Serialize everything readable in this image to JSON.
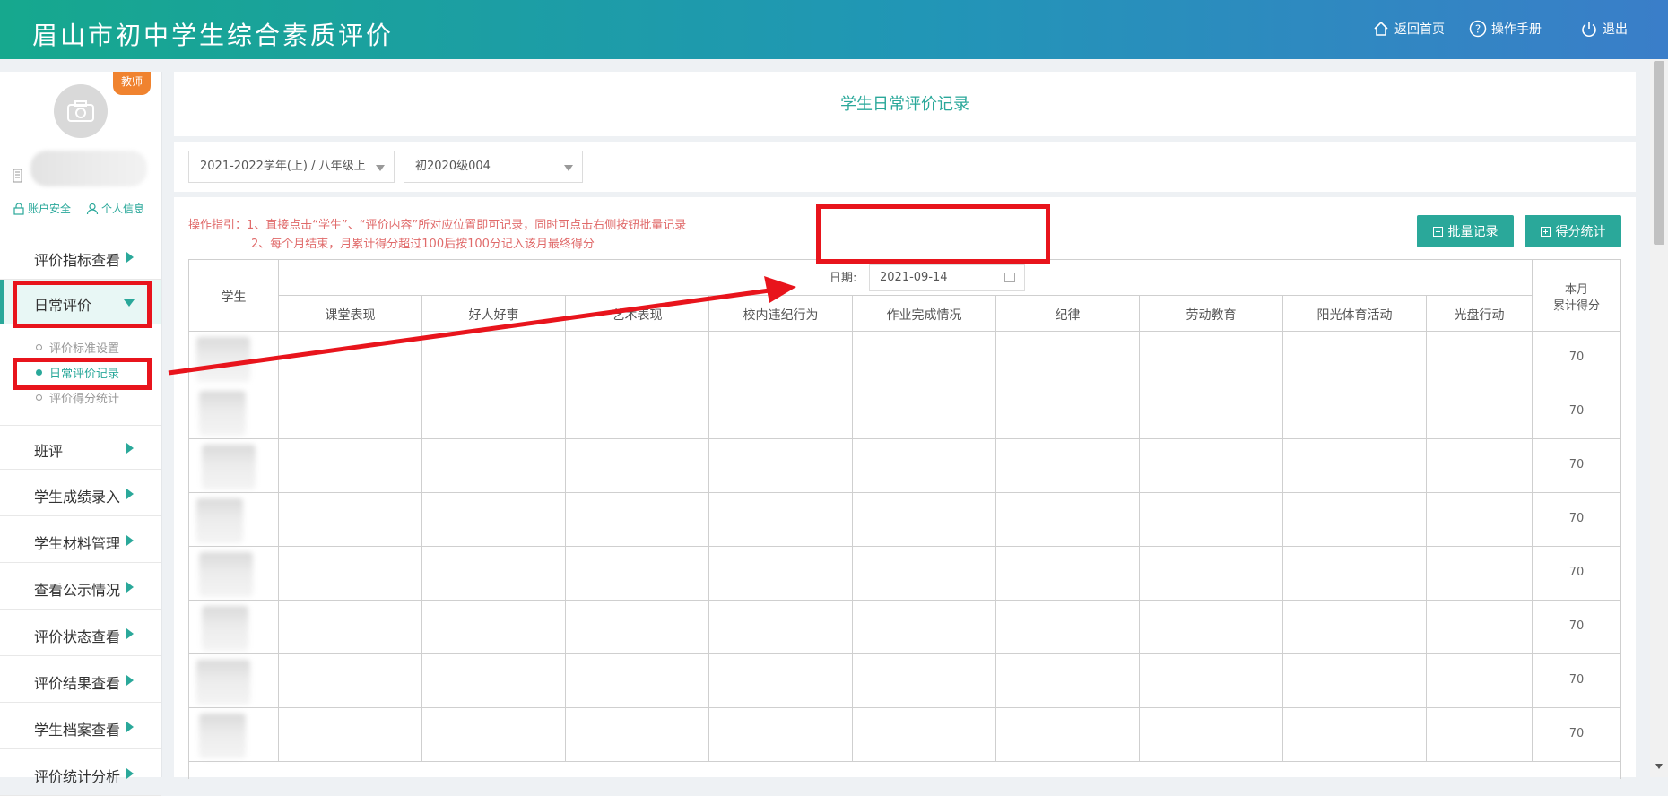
{
  "header": {
    "app_title": "眉山市初中学生综合素质评价",
    "links": [
      {
        "label": "返回首页",
        "icon": "home-icon"
      },
      {
        "label": "操作手册",
        "icon": "help-icon"
      },
      {
        "label": "退出",
        "icon": "power-icon"
      }
    ]
  },
  "profile": {
    "role_badge": "教师",
    "account_security": "账户安全",
    "personal_info": "个人信息"
  },
  "sidebar": {
    "items": [
      {
        "label": "评价指标查看"
      },
      {
        "label": "日常评价"
      },
      {
        "label": "班评"
      },
      {
        "label": "学生成绩录入"
      },
      {
        "label": "学生材料管理"
      },
      {
        "label": "查看公示情况"
      },
      {
        "label": "评价状态查看"
      },
      {
        "label": "评价结果查看"
      },
      {
        "label": "学生档案查看"
      },
      {
        "label": "评价统计分析"
      }
    ],
    "sub_items": [
      {
        "label": "评价标准设置"
      },
      {
        "label": "日常评价记录"
      },
      {
        "label": "评价得分统计"
      }
    ]
  },
  "page": {
    "title": "学生日常评价记录",
    "filters": {
      "term": "2021-2022学年(上) / 八年级上",
      "class": "初2020级004"
    },
    "guide_line1": "操作指引：1、直接点击“学生”、“评价内容”所对应位置即可记录，同时可点击右侧按钮批量记录",
    "guide_line2": "2、每个月结束，月累计得分超过100后按100分记入该月最终得分",
    "buttons": {
      "batch_record": "批量记录",
      "score_stats": "得分统计"
    },
    "date_label": "日期:",
    "date_value": "2021-09-14"
  },
  "table": {
    "student_header": "学生",
    "columns": [
      "课堂表现",
      "好人好事",
      "艺术表现",
      "校内违纪行为",
      "作业完成情况",
      "纪律",
      "劳动教育",
      "阳光体育活动",
      "光盘行动"
    ],
    "monthly_header_line1": "本月",
    "monthly_header_line2": "累计得分",
    "scores": [
      "70",
      "70",
      "70",
      "70",
      "70",
      "70",
      "70",
      "70"
    ]
  },
  "colors": {
    "accent": "#2aa89a",
    "annotation_red": "#e8141c",
    "guide_text": "#e06a6a"
  }
}
